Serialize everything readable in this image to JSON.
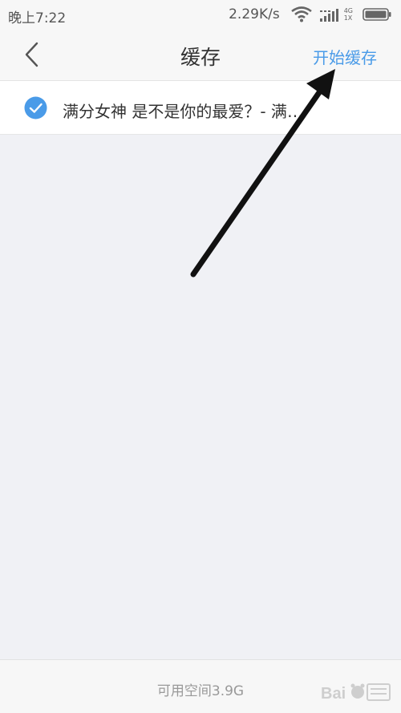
{
  "status_bar": {
    "time": "晚上7:22",
    "speed": "2.29K/s",
    "network_top": "4G",
    "network_bottom": "1X",
    "icons": [
      "wifi-icon",
      "signal-icon",
      "battery-icon"
    ]
  },
  "nav": {
    "title": "缓存",
    "start_label": "开始缓存",
    "back_icon": "chevron-left-icon"
  },
  "list": {
    "items": [
      {
        "title": "满分女神 是不是你的最爱？- 满分女神",
        "checked": true
      }
    ]
  },
  "footer": {
    "free_space": "可用空间3.9G"
  },
  "colors": {
    "accent": "#4a9be8",
    "background": "#f0f1f5",
    "bar": "#f7f7f7",
    "arrow": "#111111"
  }
}
